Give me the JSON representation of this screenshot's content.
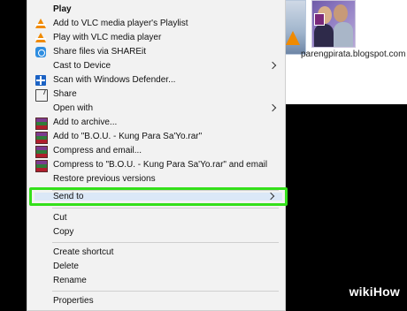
{
  "desktop": {
    "file_label": "parengpirata.blogspot.com"
  },
  "watermark": {
    "part1": "wiki",
    "part2": "How"
  },
  "menu": {
    "items": [
      {
        "label": "Play",
        "icon": "none"
      },
      {
        "label": "Add to VLC media player's Playlist",
        "icon": "vlc-cone-icon"
      },
      {
        "label": "Play with VLC media player",
        "icon": "vlc-cone-icon"
      },
      {
        "label": "Share files via SHAREit",
        "icon": "shareit-icon"
      },
      {
        "label": "Cast to Device",
        "icon": "none"
      },
      {
        "label": "Scan with Windows Defender...",
        "icon": "windows-defender-icon"
      },
      {
        "label": "Share",
        "icon": "share-icon"
      },
      {
        "label": "Open with",
        "icon": "none"
      },
      {
        "label": "Add to archive...",
        "icon": "winrar-icon"
      },
      {
        "label": "Add to \"B.O.U. - Kung Para Sa'Yo.rar\"",
        "icon": "winrar-icon"
      },
      {
        "label": "Compress and email...",
        "icon": "winrar-icon"
      },
      {
        "label": "Compress to \"B.O.U. - Kung Para Sa'Yo.rar\" and email",
        "icon": "winrar-icon"
      },
      {
        "label": "Restore previous versions",
        "icon": "none"
      },
      {
        "label": "Send to",
        "icon": "none"
      },
      {
        "label": "Cut",
        "icon": "none"
      },
      {
        "label": "Copy",
        "icon": "none"
      },
      {
        "label": "Create shortcut",
        "icon": "none"
      },
      {
        "label": "Delete",
        "icon": "none"
      },
      {
        "label": "Rename",
        "icon": "none"
      },
      {
        "label": "Properties",
        "icon": "none"
      }
    ],
    "highlight_color": "#34e01a",
    "background": "#f2f2f2"
  }
}
